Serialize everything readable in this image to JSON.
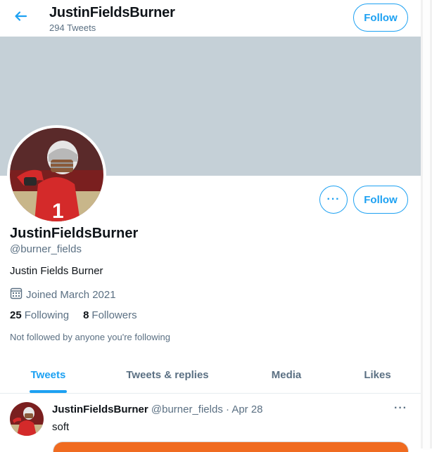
{
  "header": {
    "title": "JustinFieldsBurner",
    "subtitle": "294 Tweets",
    "follow_label": "Follow"
  },
  "profile": {
    "more_label": "···",
    "follow_label": "Follow",
    "name": "JustinFieldsBurner",
    "handle": "@burner_fields",
    "bio": "Justin Fields Burner",
    "joined": "Joined March 2021",
    "following_count": "25",
    "following_label": "Following",
    "followers_count": "8",
    "followers_label": "Followers",
    "not_followed": "Not followed by anyone you're following"
  },
  "tabs": [
    {
      "label": "Tweets",
      "active": true
    },
    {
      "label": "Tweets & replies"
    },
    {
      "label": "Media"
    },
    {
      "label": "Likes"
    }
  ],
  "tweet": {
    "name": "JustinFieldsBurner",
    "meta": "@burner_fields · Apr 28",
    "more_label": "···",
    "text": "soft"
  },
  "colors": {
    "accent": "#1da1f2",
    "banner": "#c5d0d7",
    "muted": "#5b7083",
    "media": "#f06b20"
  },
  "icons": [
    "back-arrow-icon",
    "calendar-icon",
    "more-icon",
    "avatar-photo"
  ]
}
